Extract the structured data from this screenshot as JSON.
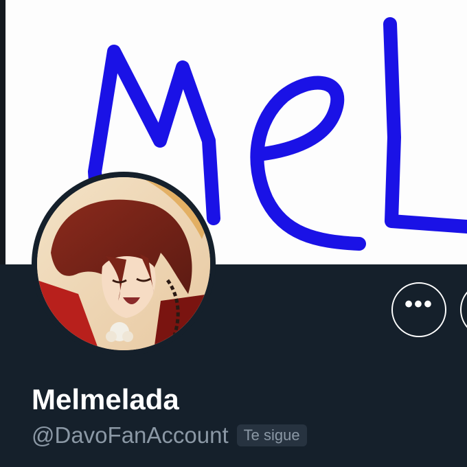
{
  "profile": {
    "display_name": "Melmelada",
    "handle": "@DavoFanAccount",
    "follows_you_badge": "Te sigue"
  },
  "banner": {
    "drawing_text": "MeL",
    "drawing_color": "#1a12e6"
  },
  "actions": {
    "more_label": "•••"
  },
  "colors": {
    "background": "#15202b",
    "text_primary": "#ffffff",
    "text_secondary": "#8b98a5",
    "badge_bg": "#273340"
  },
  "icons": {
    "more": "more-horizontal-icon"
  }
}
